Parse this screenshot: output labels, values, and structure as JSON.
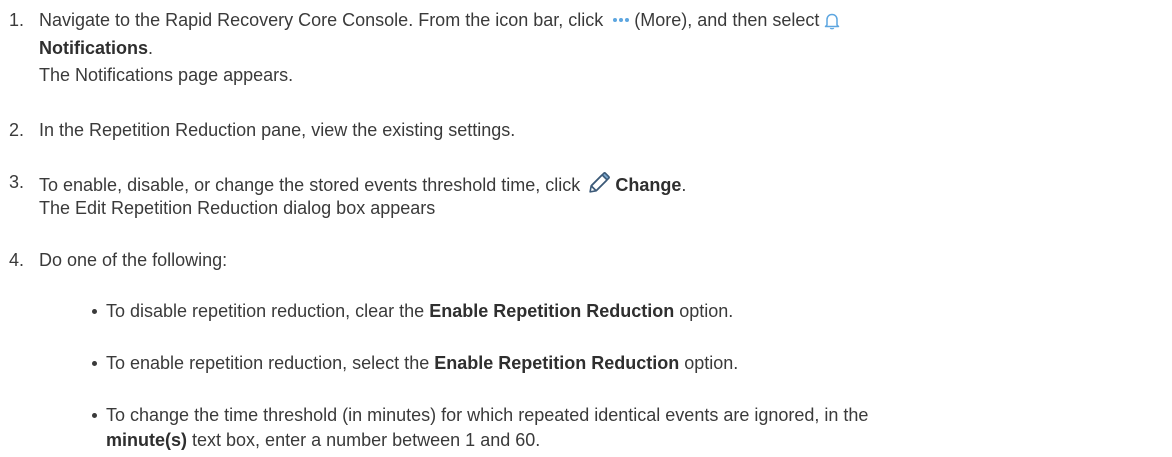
{
  "steps": [
    {
      "number": "1.",
      "text_before_more": "Navigate to the Rapid Recovery Core Console. From the icon bar, click",
      "more_label": "(More), and then select",
      "more_icon": "more-dots-icon",
      "bell_icon": "bell-icon",
      "bold": "Notifications",
      "period": ".",
      "result": "The Notifications page appears."
    },
    {
      "number": "2.",
      "text": "In the Repetition Reduction pane, view the existing settings."
    },
    {
      "number": "3.",
      "text": "To enable, disable, or change the stored events threshold time, click",
      "pencil_icon": "pencil-icon",
      "bold": "Change",
      "period": ".",
      "result": "The Edit Repetition Reduction dialog box appears"
    },
    {
      "number": "4.",
      "text": "Do one of the following:"
    }
  ],
  "bullets": [
    {
      "before": "To disable repetition reduction, clear the",
      "bold": "Enable Repetition Reduction",
      "after": "option."
    },
    {
      "before": "To enable repetition reduction, select the",
      "bold": "Enable Repetition Reduction",
      "after": "option."
    },
    {
      "line1": "To change the time threshold (in minutes) for which repeated identical events are ignored, in the",
      "bold": "minute(s)",
      "after": "text box, enter a number between 1 and 60."
    }
  ],
  "colors": {
    "text": "#3a3a3a",
    "icon_accent": "#5da6e0"
  }
}
